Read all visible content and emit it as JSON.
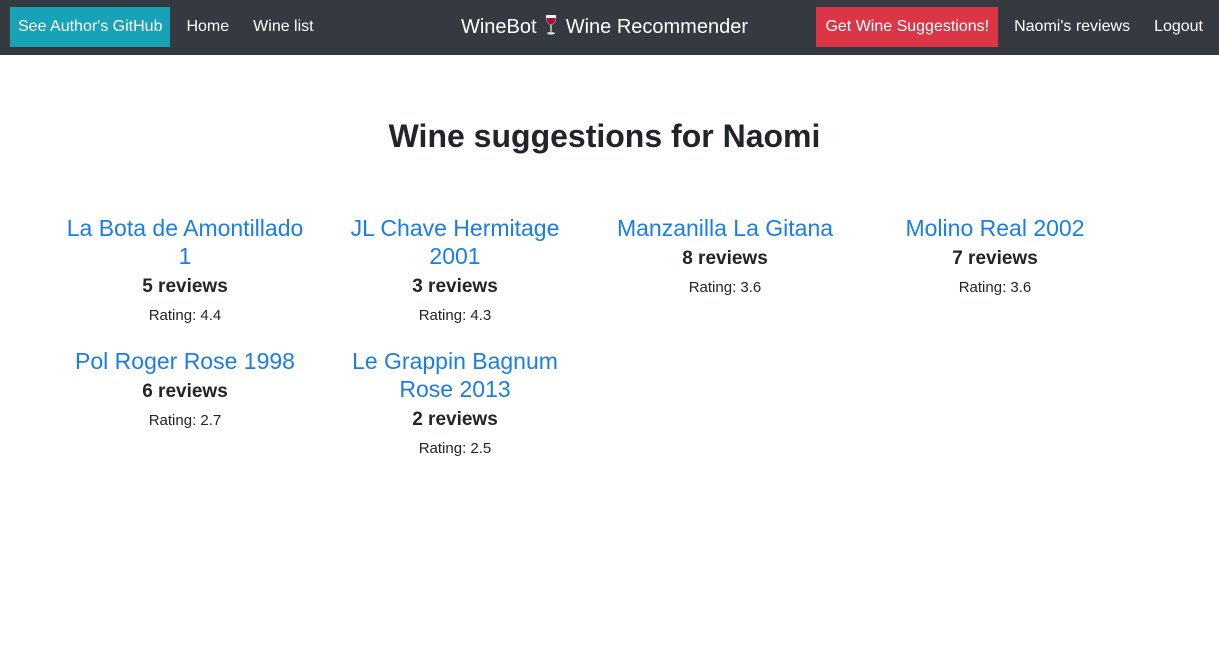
{
  "navbar": {
    "github_label": "See Author's GitHub",
    "home_label": "Home",
    "wine_list_label": "Wine list",
    "brand_prefix": "WineBot",
    "brand_suffix": "Wine Recommender",
    "brand_icon": "wine-glass-icon",
    "suggest_label": "Get Wine Suggestions!",
    "reviews_label": "Naomi's reviews",
    "logout_label": "Logout",
    "colors": {
      "background": "#343a40",
      "github_button": "#17a2b8",
      "suggest_button": "#dc3545",
      "link": "#1a7ee8"
    }
  },
  "main": {
    "title": "Wine suggestions for Naomi",
    "wines": [
      {
        "name": "La Bota de Amontillado 1",
        "reviews": "5 reviews",
        "rating": "Rating: 4.4"
      },
      {
        "name": "JL Chave Hermitage 2001",
        "reviews": "3 reviews",
        "rating": "Rating: 4.3"
      },
      {
        "name": "Manzanilla La Gitana",
        "reviews": "8 reviews",
        "rating": "Rating: 3.6"
      },
      {
        "name": "Molino Real 2002",
        "reviews": "7 reviews",
        "rating": "Rating: 3.6"
      },
      {
        "name": "Pol Roger Rose 1998",
        "reviews": "6 reviews",
        "rating": "Rating: 2.7"
      },
      {
        "name": "Le Grappin Bagnum Rose 2013",
        "reviews": "2 reviews",
        "rating": "Rating: 2.5"
      }
    ]
  }
}
